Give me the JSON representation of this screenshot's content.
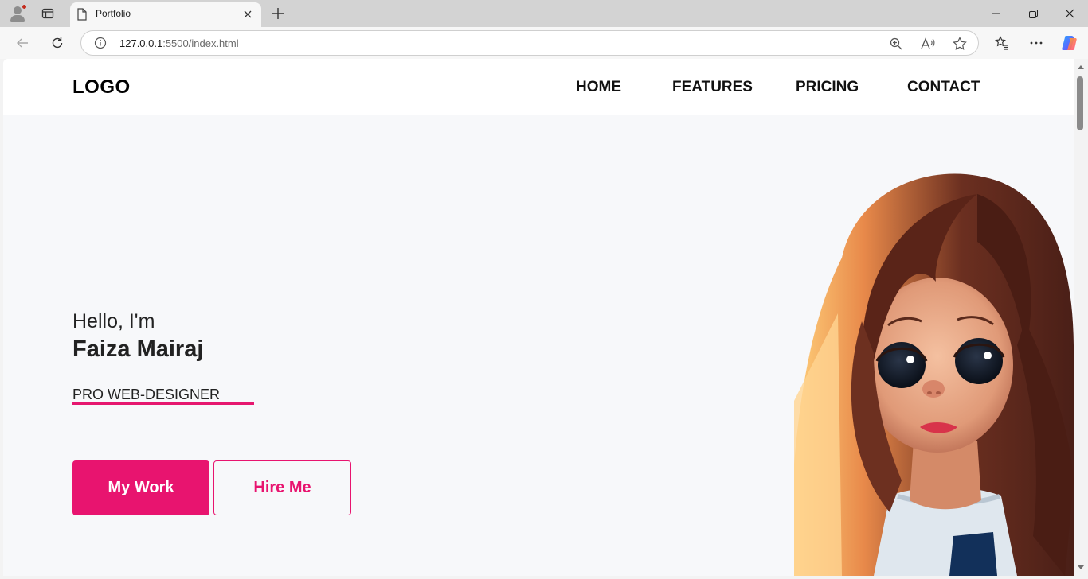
{
  "browser": {
    "tab_title": "Portfolio",
    "url_host": "127.0.0.1",
    "url_rest": ":5500/index.html"
  },
  "site": {
    "logo": "LOGO",
    "nav": [
      "HOME",
      "FEATURES",
      "PRICING",
      "CONTACT"
    ],
    "hero": {
      "greeting": "Hello, I'm",
      "name": "Faiza Mairaj",
      "role": "PRO WEB-DESIGNER",
      "primary_button": "My Work",
      "secondary_button": "Hire Me"
    }
  },
  "colors": {
    "accent": "#e8146f",
    "page_bg": "#f7f8fa",
    "nav_bg": "#ffffff"
  },
  "icons": [
    "profile-icon",
    "tab-actions-icon",
    "page-icon",
    "close-icon",
    "new-tab-icon",
    "minimize-icon",
    "restore-icon",
    "window-close-icon",
    "back-icon",
    "reload-icon",
    "info-icon",
    "zoom-icon",
    "read-aloud-icon",
    "favorite-icon",
    "favorites-icon",
    "more-icon",
    "copilot-icon"
  ]
}
